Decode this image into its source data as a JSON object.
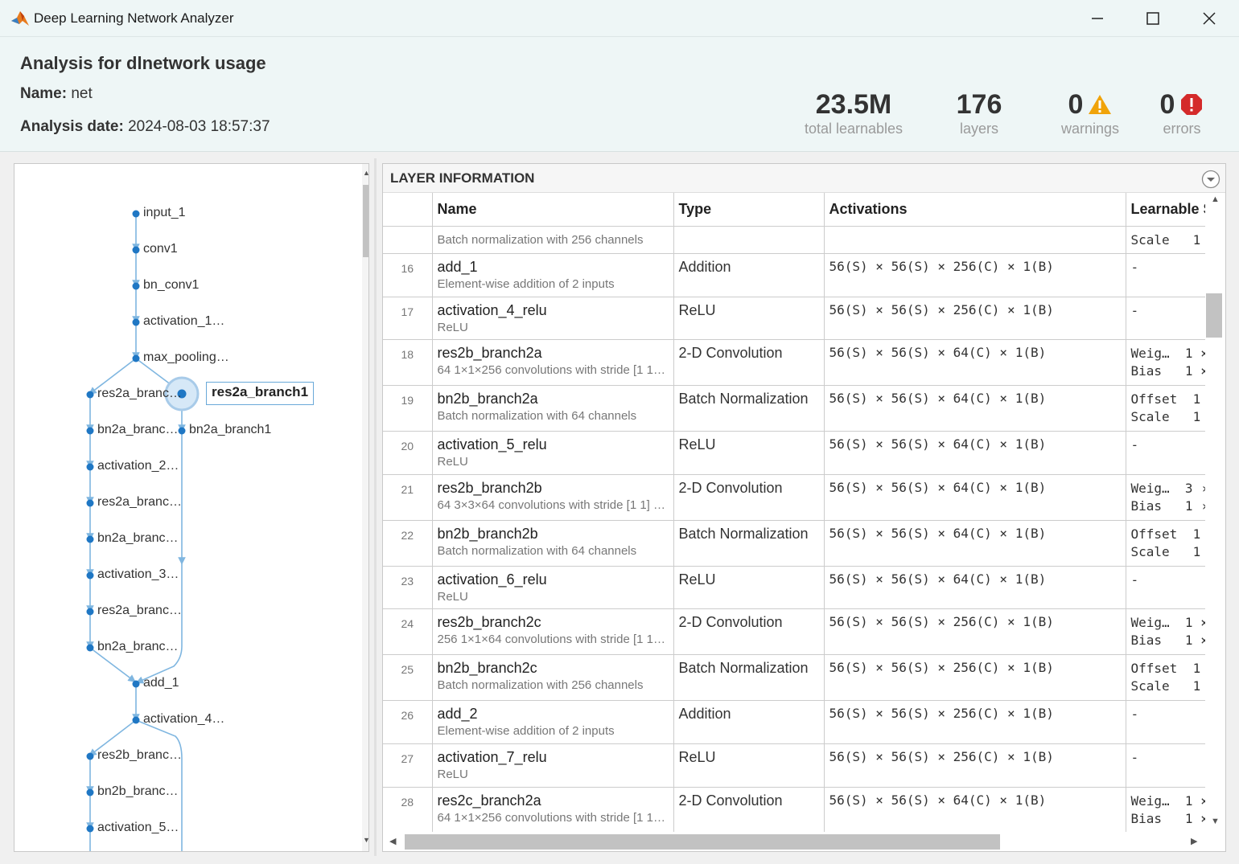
{
  "window": {
    "title": "Deep Learning Network Analyzer",
    "icons": [
      "matlab-logo-icon",
      "minimize-icon",
      "maximize-icon",
      "close-icon"
    ]
  },
  "header": {
    "title": "Analysis for dlnetwork usage",
    "name_label": "Name:",
    "name_value": "net",
    "date_label": "Analysis date:",
    "date_value": "2024-08-03 18:57:37",
    "stats": {
      "learnables": {
        "value": "23.5M",
        "label": "total learnables"
      },
      "layers": {
        "value": "176",
        "label": "layers"
      },
      "warnings": {
        "value": "0",
        "label": "warnings"
      },
      "errors": {
        "value": "0",
        "label": "errors"
      }
    }
  },
  "graph": {
    "selected_node": "res2a_branch1",
    "nodes": [
      {
        "id": "input_1",
        "label": "input_1"
      },
      {
        "id": "conv1",
        "label": "conv1"
      },
      {
        "id": "bn_conv1",
        "label": "bn_conv1"
      },
      {
        "id": "activation_1",
        "label": "activation_1…"
      },
      {
        "id": "max_pooling",
        "label": "max_pooling…"
      },
      {
        "id": "res2a_branch2a",
        "label": "res2a_branc…"
      },
      {
        "id": "bn2a_branch2a",
        "label": "bn2a_branc…"
      },
      {
        "id": "bn2a_branch1",
        "label": "bn2a_branch1"
      },
      {
        "id": "activation_2",
        "label": "activation_2…"
      },
      {
        "id": "res2a_branch2b",
        "label": "res2a_branc…"
      },
      {
        "id": "bn2a_branch2b",
        "label": "bn2a_branc…"
      },
      {
        "id": "activation_3",
        "label": "activation_3…"
      },
      {
        "id": "res2a_branch2c",
        "label": "res2a_branc…"
      },
      {
        "id": "bn2a_branch2c",
        "label": "bn2a_branc…"
      },
      {
        "id": "add_1",
        "label": "add_1"
      },
      {
        "id": "activation_4",
        "label": "activation_4…"
      },
      {
        "id": "res2b_branch2a",
        "label": "res2b_branc…"
      },
      {
        "id": "bn2b_branch2a",
        "label": "bn2b_branc…"
      },
      {
        "id": "activation_5",
        "label": "activation_5…"
      }
    ]
  },
  "layer_info": {
    "title": "LAYER INFORMATION",
    "columns": [
      "",
      "Name",
      "Type",
      "Activations",
      "Learnable S"
    ],
    "partial_row": {
      "desc": "Batch normalization with 256 channels",
      "learnables": "Scale   1"
    },
    "rows": [
      {
        "idx": "16",
        "name": "add_1",
        "desc": "Element-wise addition of 2 inputs",
        "type": "Addition",
        "act": "56(S) × 56(S) × 256(C) × 1(B)",
        "learn": "-"
      },
      {
        "idx": "17",
        "name": "activation_4_relu",
        "desc": "ReLU",
        "type": "ReLU",
        "act": "56(S) × 56(S) × 256(C) × 1(B)",
        "learn": "-"
      },
      {
        "idx": "18",
        "name": "res2b_branch2a",
        "desc": "64 1×1×256 convolutions with stride [1 1…",
        "type": "2-D Convolution",
        "act": "56(S) × 56(S) × 64(C) × 1(B)",
        "learn": "Weig…  1 ×\nBias   1 ×"
      },
      {
        "idx": "19",
        "name": "bn2b_branch2a",
        "desc": "Batch normalization with 64 channels",
        "type": "Batch Normalization",
        "act": "56(S) × 56(S) × 64(C) × 1(B)",
        "learn": "Offset  1\nScale   1"
      },
      {
        "idx": "20",
        "name": "activation_5_relu",
        "desc": "ReLU",
        "type": "ReLU",
        "act": "56(S) × 56(S) × 64(C) × 1(B)",
        "learn": "-"
      },
      {
        "idx": "21",
        "name": "res2b_branch2b",
        "desc": "64 3×3×64 convolutions with stride [1 1] …",
        "type": "2-D Convolution",
        "act": "56(S) × 56(S) × 64(C) × 1(B)",
        "learn": "Weig…  3 ›\nBias   1 ›"
      },
      {
        "idx": "22",
        "name": "bn2b_branch2b",
        "desc": "Batch normalization with 64 channels",
        "type": "Batch Normalization",
        "act": "56(S) × 56(S) × 64(C) × 1(B)",
        "learn": "Offset  1\nScale   1"
      },
      {
        "idx": "23",
        "name": "activation_6_relu",
        "desc": "ReLU",
        "type": "ReLU",
        "act": "56(S) × 56(S) × 64(C) × 1(B)",
        "learn": "-"
      },
      {
        "idx": "24",
        "name": "res2b_branch2c",
        "desc": "256 1×1×64 convolutions with stride [1 1…",
        "type": "2-D Convolution",
        "act": "56(S) × 56(S) × 256(C) × 1(B)",
        "learn": "Weig…  1 ×\nBias   1 ×"
      },
      {
        "idx": "25",
        "name": "bn2b_branch2c",
        "desc": "Batch normalization with 256 channels",
        "type": "Batch Normalization",
        "act": "56(S) × 56(S) × 256(C) × 1(B)",
        "learn": "Offset  1\nScale   1"
      },
      {
        "idx": "26",
        "name": "add_2",
        "desc": "Element-wise addition of 2 inputs",
        "type": "Addition",
        "act": "56(S) × 56(S) × 256(C) × 1(B)",
        "learn": "-"
      },
      {
        "idx": "27",
        "name": "activation_7_relu",
        "desc": "ReLU",
        "type": "ReLU",
        "act": "56(S) × 56(S) × 256(C) × 1(B)",
        "learn": "-"
      },
      {
        "idx": "28",
        "name": "res2c_branch2a",
        "desc": "64 1×1×256 convolutions with stride [1 1…",
        "type": "2-D Convolution",
        "act": "56(S) × 56(S) × 64(C) × 1(B)",
        "learn": "Weig…  1 ×\nBias   1 ×"
      }
    ]
  },
  "colors": {
    "node": "#1f77c4",
    "edge": "#7fb6e0",
    "warning": "#f0a30a",
    "error": "#d42a2a"
  }
}
